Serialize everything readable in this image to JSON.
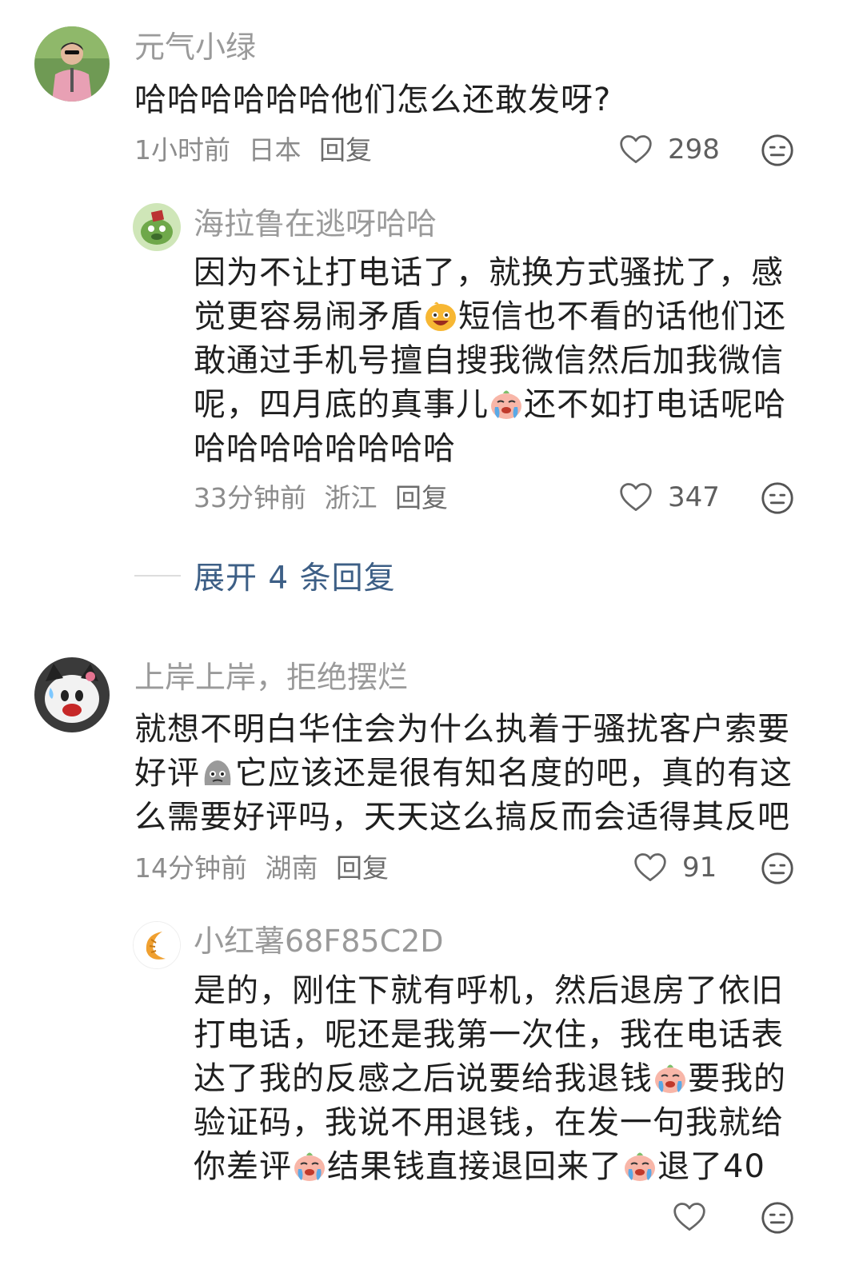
{
  "comments": [
    {
      "username": "元气小绿",
      "lines": [
        "哈哈哈哈哈哈他们怎么还敢发呀?"
      ],
      "time": "1小时前",
      "location": "日本",
      "reply_label": "回复",
      "likes": "298"
    },
    {
      "username": "海拉鲁在逃呀哈哈",
      "lines": [
        "因为不让打电话了，就换方式骚扰了，感",
        "觉更容易闹矛盾",
        "短信也不看的话他们还",
        "敢通过手机号擅自搜我微信然后加我微信",
        "呢，四月底的真事儿",
        "还不如打电话呢哈",
        "哈哈哈哈哈哈哈哈"
      ],
      "time": "33分钟前",
      "location": "浙江",
      "reply_label": "回复",
      "likes": "347"
    },
    {
      "username": "上岸上岸，拒绝摆烂",
      "lines": [
        "就想不明白华住会为什么执着于骚扰客户索要",
        "好评",
        "它应该还是很有知名度的吧，真的有这",
        "么需要好评吗，天天这么搞反而会适得其反吧"
      ],
      "time": "14分钟前",
      "location": "湖南",
      "reply_label": "回复",
      "likes": "91"
    },
    {
      "username": "小红薯68F85C2D",
      "lines": [
        "是的，刚住下就有呼机，然后退房了依旧",
        "打电话，呢还是我第一次住，我在电话表",
        "达了我的反感之后说要给我退钱",
        "要我的",
        "验证码，我说不用退钱，在发一句我就给",
        "你差评",
        "结果钱直接退回来了",
        "退了40"
      ]
    }
  ],
  "expand_replies": "展开 4 条回复",
  "icons": {
    "like": "heart-outline-icon",
    "dislike": "neutral-face-icon",
    "emoji_grin": "grinning-face-emoji",
    "emoji_cry": "crying-face-emoji",
    "emoji_grey": "grey-blob-emoji"
  },
  "colors": {
    "username": "#9a9a9a",
    "meta": "#8c8c8c",
    "expand_link": "#3d5f86"
  }
}
